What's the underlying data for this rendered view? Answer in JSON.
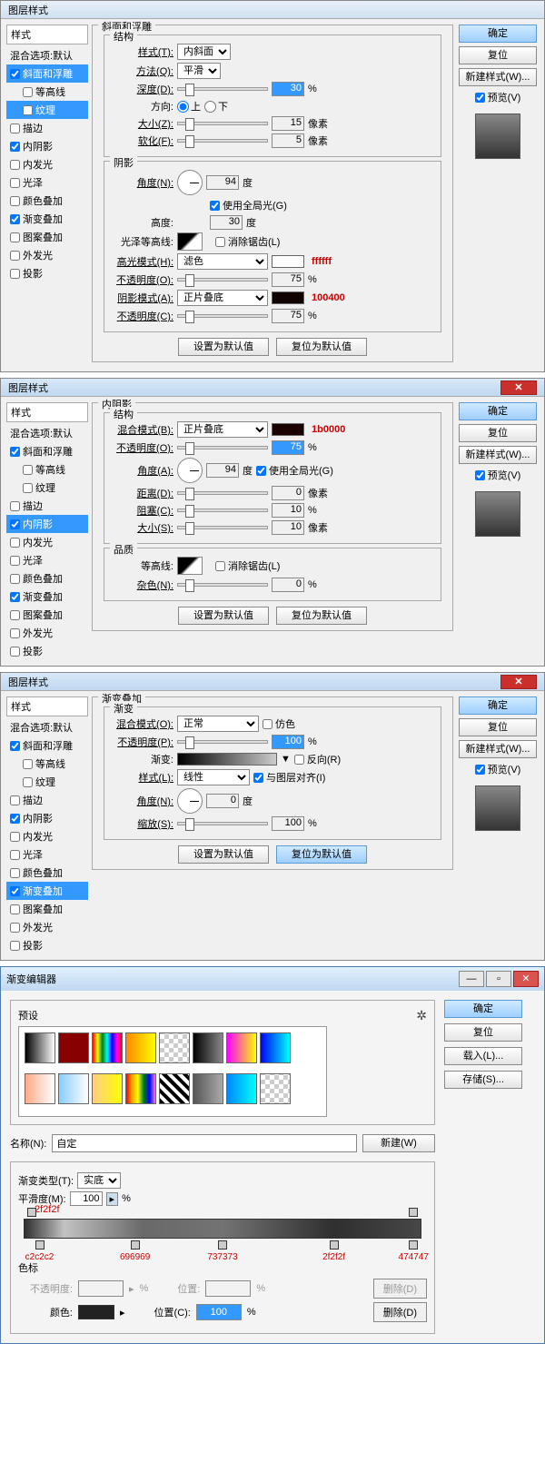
{
  "dialogs": [
    {
      "title": "图层样式",
      "section": "斜面和浮雕",
      "subsection": "结构",
      "styles_header": "样式",
      "blend_options": "混合选项:默认",
      "style_list": [
        {
          "label": "斜面和浮雕",
          "chk": true,
          "sel": true
        },
        {
          "label": "等高线",
          "chk": false,
          "sub": true
        },
        {
          "label": "纹理",
          "chk": false,
          "sel": true,
          "sub": true
        },
        {
          "label": "描边",
          "chk": false
        },
        {
          "label": "内阴影",
          "chk": true
        },
        {
          "label": "内发光",
          "chk": false
        },
        {
          "label": "光泽",
          "chk": false
        },
        {
          "label": "颜色叠加",
          "chk": false
        },
        {
          "label": "渐变叠加",
          "chk": true
        },
        {
          "label": "图案叠加",
          "chk": false
        },
        {
          "label": "外发光",
          "chk": false
        },
        {
          "label": "投影",
          "chk": false
        }
      ],
      "rows": {
        "style": {
          "lbl": "样式(T):",
          "val": "内斜面"
        },
        "technique": {
          "lbl": "方法(Q):",
          "val": "平滑"
        },
        "depth": {
          "lbl": "深度(D):",
          "val": "30",
          "unit": "%"
        },
        "direction": {
          "lbl": "方向:",
          "up": "上",
          "down": "下"
        },
        "size": {
          "lbl": "大小(Z):",
          "val": "15",
          "unit": "像素"
        },
        "soften": {
          "lbl": "软化(F):",
          "val": "5",
          "unit": "像素"
        }
      },
      "shade_title": "阴影",
      "shade": {
        "angle": {
          "lbl": "角度(N):",
          "val": "94",
          "unit": "度"
        },
        "global": {
          "lbl": "使用全局光(G)"
        },
        "altitude": {
          "lbl": "高度:",
          "val": "30",
          "unit": "度"
        },
        "gloss": {
          "lbl": "光泽等高线:",
          "anti": "消除锯齿(L)"
        },
        "hmode": {
          "lbl": "高光模式(H):",
          "val": "滤色",
          "color": "#ffffff",
          "annot": "ffffff"
        },
        "hop": {
          "lbl": "不透明度(O):",
          "val": "75",
          "unit": "%"
        },
        "smode": {
          "lbl": "阴影模式(A):",
          "val": "正片叠底",
          "color": "#100400",
          "annot": "100400"
        },
        "sop": {
          "lbl": "不透明度(C):",
          "val": "75",
          "unit": "%"
        }
      },
      "btns": {
        "ok": "确定",
        "cancel": "复位",
        "new": "新建样式(W)...",
        "preview": "预览(V)",
        "makedef": "设置为默认值",
        "resetdef": "复位为默认值"
      }
    },
    {
      "title": "图层样式",
      "section": "内阴影",
      "subsection": "结构",
      "styles_header": "样式",
      "blend_options": "混合选项:默认",
      "style_list": [
        {
          "label": "斜面和浮雕",
          "chk": true
        },
        {
          "label": "等高线",
          "chk": false,
          "sub": true
        },
        {
          "label": "纹理",
          "chk": false,
          "sub": true
        },
        {
          "label": "描边",
          "chk": false
        },
        {
          "label": "内阴影",
          "chk": true,
          "sel": true
        },
        {
          "label": "内发光",
          "chk": false
        },
        {
          "label": "光泽",
          "chk": false
        },
        {
          "label": "颜色叠加",
          "chk": false
        },
        {
          "label": "渐变叠加",
          "chk": true
        },
        {
          "label": "图案叠加",
          "chk": false
        },
        {
          "label": "外发光",
          "chk": false
        },
        {
          "label": "投影",
          "chk": false
        }
      ],
      "rows": {
        "blend": {
          "lbl": "混合模式(B):",
          "val": "正片叠底",
          "color": "#1b0000",
          "annot": "1b0000"
        },
        "opacity": {
          "lbl": "不透明度(O):",
          "val": "75",
          "unit": "%",
          "hl": true
        },
        "angle": {
          "lbl": "角度(A):",
          "val": "94",
          "unit": "度",
          "global": "使用全局光(G)"
        },
        "dist": {
          "lbl": "距离(D):",
          "val": "0",
          "unit": "像素"
        },
        "choke": {
          "lbl": "阻塞(C):",
          "val": "10",
          "unit": "%"
        },
        "size": {
          "lbl": "大小(S):",
          "val": "10",
          "unit": "像素"
        }
      },
      "quality_title": "品质",
      "quality": {
        "contour": {
          "lbl": "等高线:",
          "anti": "消除锯齿(L)"
        },
        "noise": {
          "lbl": "杂色(N):",
          "val": "0",
          "unit": "%"
        }
      },
      "btns": {
        "ok": "确定",
        "cancel": "复位",
        "new": "新建样式(W)...",
        "preview": "预览(V)",
        "makedef": "设置为默认值",
        "resetdef": "复位为默认值"
      }
    },
    {
      "title": "图层样式",
      "section": "渐变叠加",
      "subsection": "渐变",
      "styles_header": "样式",
      "blend_options": "混合选项:默认",
      "style_list": [
        {
          "label": "斜面和浮雕",
          "chk": true
        },
        {
          "label": "等高线",
          "chk": false,
          "sub": true
        },
        {
          "label": "纹理",
          "chk": false,
          "sub": true
        },
        {
          "label": "描边",
          "chk": false
        },
        {
          "label": "内阴影",
          "chk": true
        },
        {
          "label": "内发光",
          "chk": false
        },
        {
          "label": "光泽",
          "chk": false
        },
        {
          "label": "颜色叠加",
          "chk": false
        },
        {
          "label": "渐变叠加",
          "chk": true,
          "sel": true
        },
        {
          "label": "图案叠加",
          "chk": false
        },
        {
          "label": "外发光",
          "chk": false
        },
        {
          "label": "投影",
          "chk": false
        }
      ],
      "rows": {
        "blend": {
          "lbl": "混合模式(O):",
          "val": "正常",
          "dither": "仿色"
        },
        "opacity": {
          "lbl": "不透明度(P):",
          "val": "100",
          "unit": "%",
          "hl": true
        },
        "grad": {
          "lbl": "渐变:",
          "reverse": "反向(R)"
        },
        "gstyle": {
          "lbl": "样式(L):",
          "val": "线性",
          "align": "与图层对齐(I)"
        },
        "angle": {
          "lbl": "角度(N):",
          "val": "0",
          "unit": "度"
        },
        "scale": {
          "lbl": "缩放(S):",
          "val": "100",
          "unit": "%"
        }
      },
      "btns": {
        "ok": "确定",
        "cancel": "复位",
        "new": "新建样式(W)...",
        "preview": "预览(V)",
        "makedef": "设置为默认值",
        "resetdef": "复位为默认值",
        "resetdef_hl": true
      }
    }
  ],
  "ge": {
    "title": "渐变编辑器",
    "presets_lbl": "预设",
    "presets": [
      "linear-gradient(90deg,#000,#fff)",
      "#800",
      "linear-gradient(90deg,red,yellow,green,cyan,blue,magenta,red)",
      "linear-gradient(90deg,#f80,#ff0)",
      "repeating-conic-gradient(#ccc 0 25%,#fff 0 50%) 0/10px 10px",
      "linear-gradient(90deg,#000,#888)",
      "linear-gradient(90deg,#f0f,#ff0)",
      "linear-gradient(90deg,#00f,#0ff)",
      "linear-gradient(90deg,#fa8,#fff)",
      "linear-gradient(90deg,#8cf,#fff)",
      "linear-gradient(90deg,#fc8,#ff0)",
      "linear-gradient(90deg,red,orange,yellow,green,blue,violet)",
      "repeating-linear-gradient(45deg,#000 0 4px,#fff 4px 8px)",
      "linear-gradient(90deg,#555,#aaa)",
      "linear-gradient(90deg,#08f,#0ff)",
      "repeating-conic-gradient(#ccc 0 25%,#fff 0 50%) 0/10px 10px"
    ],
    "btns": {
      "ok": "确定",
      "cancel": "复位",
      "load": "载入(L)...",
      "save": "存储(S)...",
      "new": "新建(W)"
    },
    "name_lbl": "名称(N):",
    "name_val": "自定",
    "type_lbl": "渐变类型(T):",
    "type_val": "实底",
    "smooth_lbl": "平滑度(M):",
    "smooth_val": "100",
    "smooth_unit": "%",
    "top_annot": "2f2f2f",
    "stops": [
      {
        "pos": 4,
        "label": "c2c2c2"
      },
      {
        "pos": 28,
        "label": "696969"
      },
      {
        "pos": 50,
        "label": "737373"
      },
      {
        "pos": 78,
        "label": "2f2f2f"
      },
      {
        "pos": 98,
        "label": "474747"
      }
    ],
    "stops_header": "色标",
    "opacity_row": {
      "lbl": "不透明度:",
      "unit": "%",
      "pos_lbl": "位置:",
      "del": "删除(D)"
    },
    "color_row": {
      "lbl": "颜色:",
      "pos_lbl": "位置(C):",
      "pos_val": "100",
      "del": "删除(D)"
    }
  }
}
